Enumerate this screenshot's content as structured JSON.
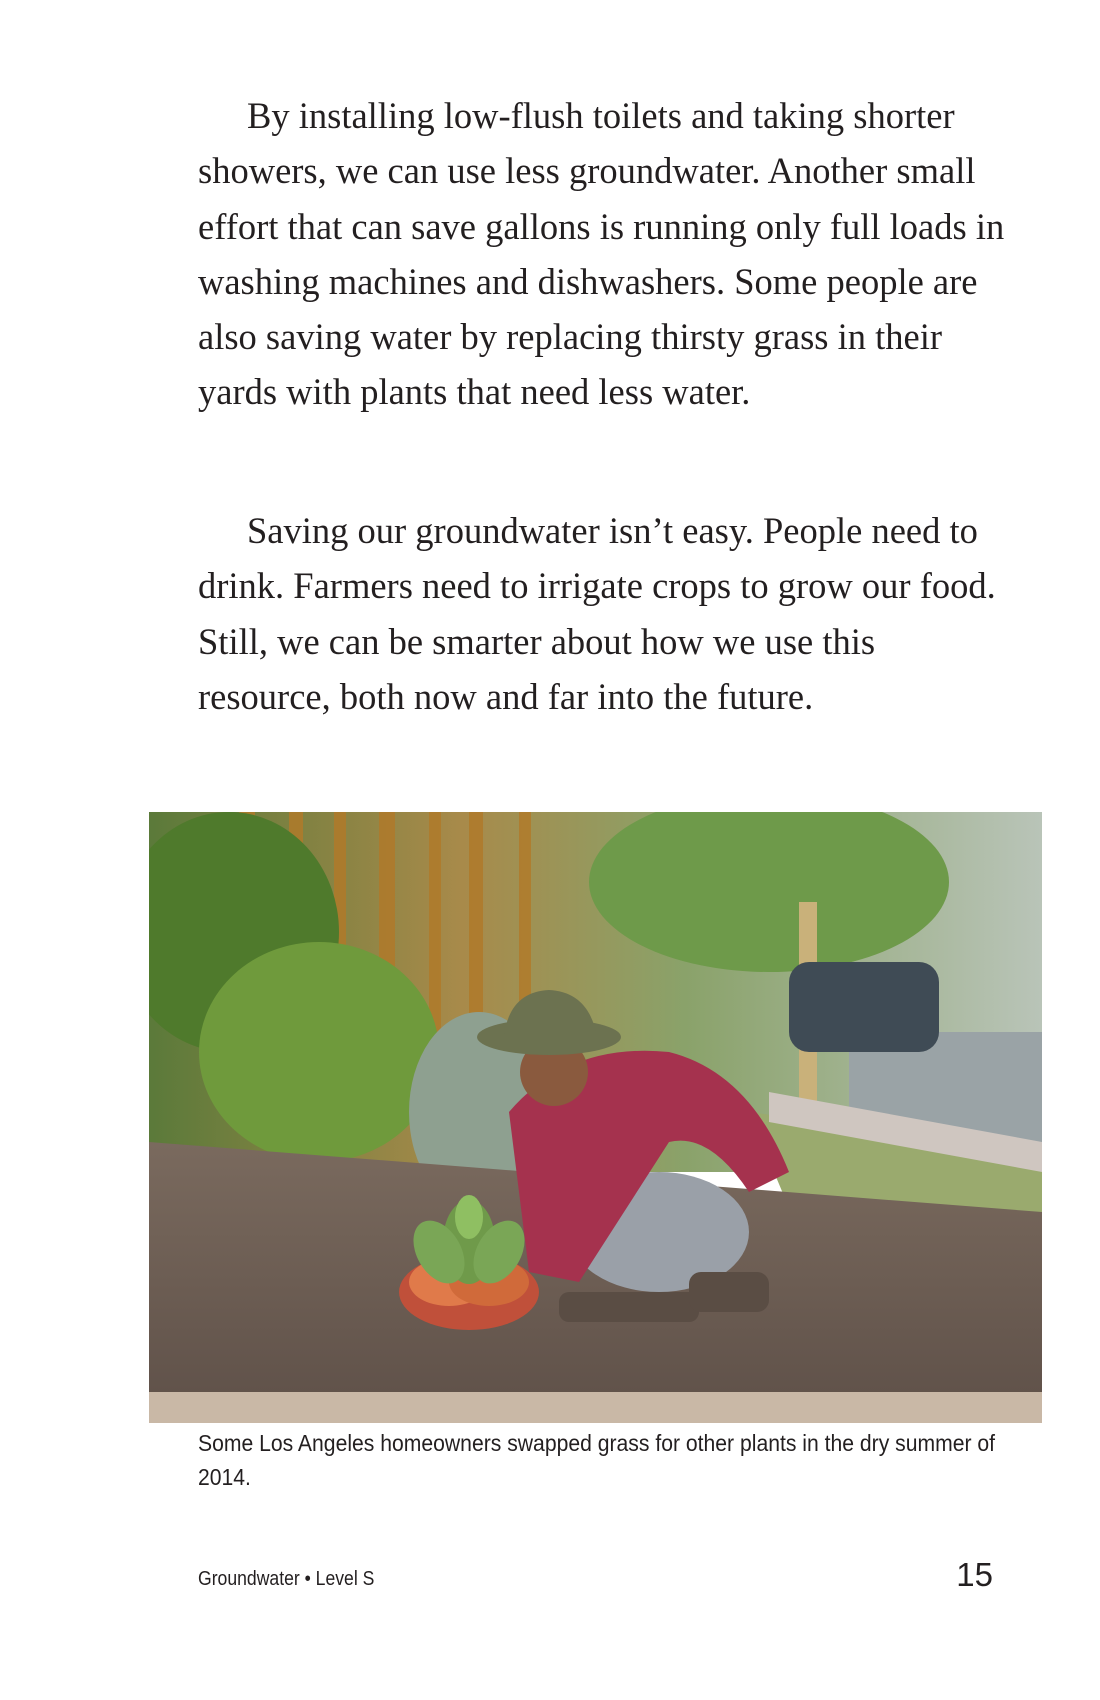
{
  "paragraphs": [
    "By installing low-flush toilets and taking shorter showers, we can use less groundwater. Another small effort that can save gallons is running only full loads in washing machines and dishwashers. Some people are also saving water by replacing thirsty grass in their yards with plants that need less water.",
    "Saving our groundwater isn’t easy. People need to drink. Farmers need to irrigate crops to grow our food. Still, we can be smarter about how we use this resource, both now and far into the future."
  ],
  "photo": {
    "caption": "Some Los Angeles homeowners swapped grass for other plants in the dry summer of 2014."
  },
  "footer": {
    "book_info": "Groundwater • Level S",
    "page_number": "15"
  }
}
